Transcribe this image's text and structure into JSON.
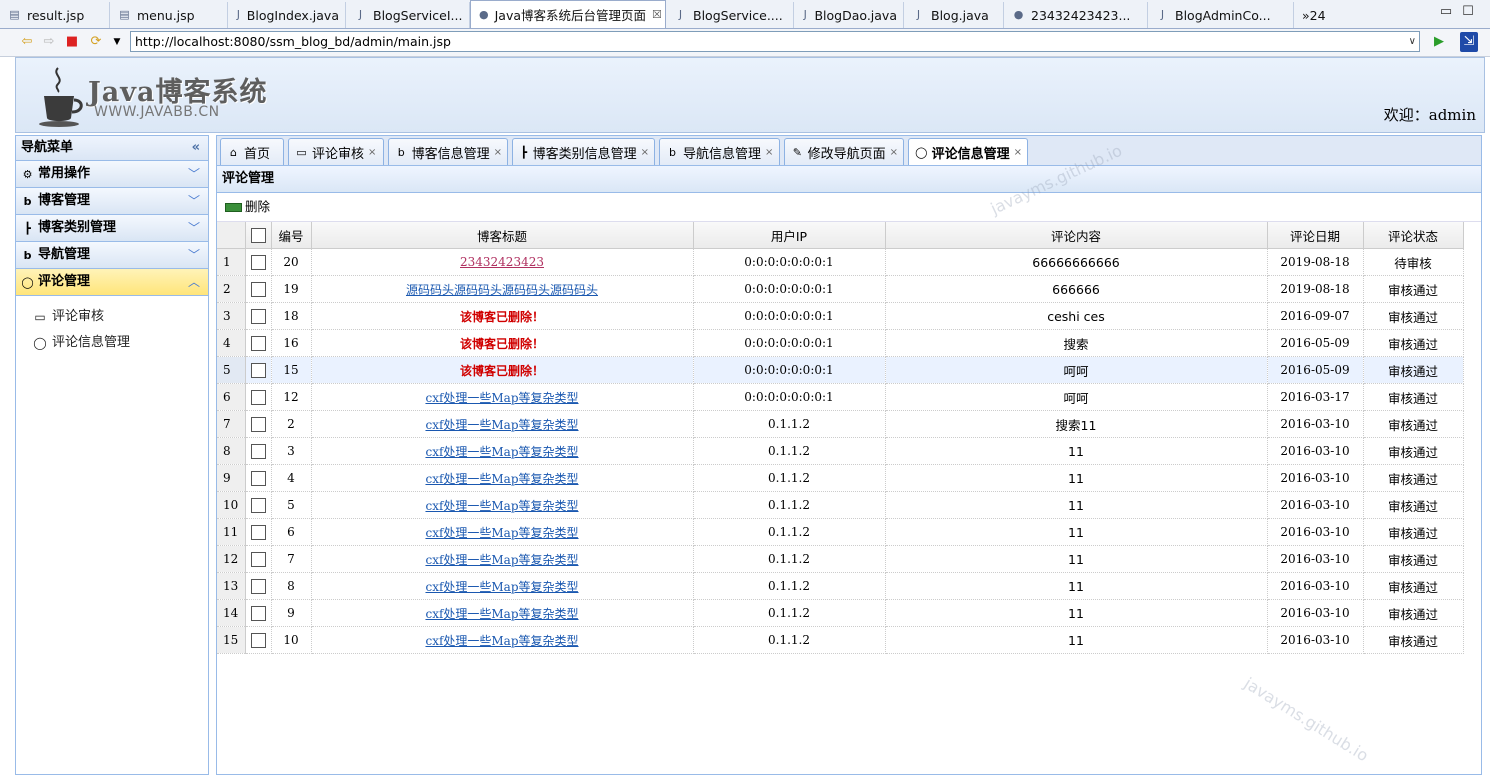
{
  "editor_tabs": [
    {
      "label": "result.jsp",
      "icon": "file-icon",
      "active": false
    },
    {
      "label": "menu.jsp",
      "icon": "file-icon",
      "active": false
    },
    {
      "label": "BlogIndex.java",
      "icon": "java-file-icon",
      "active": false
    },
    {
      "label": "BlogServiceI...",
      "icon": "java-file-icon",
      "active": false
    },
    {
      "label": "Java博客系统后台管理页面",
      "icon": "globe-icon",
      "active": true
    },
    {
      "label": "BlogService....",
      "icon": "java-file-icon",
      "active": false
    },
    {
      "label": "BlogDao.java",
      "icon": "java-file-icon",
      "active": false
    },
    {
      "label": "Blog.java",
      "icon": "java-file-icon",
      "active": false
    },
    {
      "label": "23432423423...",
      "icon": "globe-icon",
      "active": false
    },
    {
      "label": "BlogAdminCo...",
      "icon": "java-file-icon",
      "active": false
    }
  ],
  "overflow_tabs": "»24",
  "address": {
    "url": "http://localhost:8080/ssm_blog_bd/admin/main.jsp"
  },
  "header": {
    "logo_title": "Java博客系统",
    "logo_sub": "WWW.JAVABB.CN",
    "welcome": "欢迎：admin"
  },
  "nav": {
    "title": "导航菜单",
    "sections": [
      {
        "label": "常用操作",
        "icon": "gear-icon",
        "open": false
      },
      {
        "label": "博客管理",
        "icon": "blog-icon",
        "open": false
      },
      {
        "label": "博客类别管理",
        "icon": "tree-icon",
        "open": false
      },
      {
        "label": "导航管理",
        "icon": "blog-icon",
        "open": false
      },
      {
        "label": "评论管理",
        "icon": "comment-icon",
        "open": true
      }
    ],
    "sub_items": [
      {
        "label": "评论审核",
        "icon": "comment-edit-icon"
      },
      {
        "label": "评论信息管理",
        "icon": "comment-icon"
      }
    ]
  },
  "main_tabs": [
    {
      "label": "首页",
      "icon": "home-icon",
      "closable": false,
      "active": false
    },
    {
      "label": "评论审核",
      "icon": "comment-edit-icon",
      "closable": true,
      "active": false
    },
    {
      "label": "博客信息管理",
      "icon": "blog-icon",
      "closable": true,
      "active": false
    },
    {
      "label": "博客类别信息管理",
      "icon": "tree-icon",
      "closable": true,
      "active": false
    },
    {
      "label": "导航信息管理",
      "icon": "blog-icon",
      "closable": true,
      "active": false
    },
    {
      "label": "修改导航页面",
      "icon": "edit-icon",
      "closable": true,
      "active": false
    },
    {
      "label": "评论信息管理",
      "icon": "comment-icon",
      "closable": true,
      "active": true
    }
  ],
  "panel": {
    "title": "评论管理",
    "delete_label": "删除"
  },
  "table": {
    "columns": [
      "编号",
      "博客标题",
      "用户IP",
      "评论内容",
      "评论日期",
      "评论状态"
    ],
    "rows": [
      {
        "n": "1",
        "id": "20",
        "title": "23432423423",
        "title_style": "link-red",
        "ip": "0:0:0:0:0:0:0:1",
        "content": "66666666666",
        "date": "2019-08-18",
        "status": "待审核"
      },
      {
        "n": "2",
        "id": "19",
        "title": "源码码头源码码头源码码头源码码头",
        "title_style": "link",
        "ip": "0:0:0:0:0:0:0:1",
        "content": "666666",
        "date": "2019-08-18",
        "status": "审核通过"
      },
      {
        "n": "3",
        "id": "18",
        "title": "该博客已删除！",
        "title_style": "deleted",
        "ip": "0:0:0:0:0:0:0:1",
        "content": "ceshi ces",
        "date": "2016-09-07",
        "status": "审核通过"
      },
      {
        "n": "4",
        "id": "16",
        "title": "该博客已删除！",
        "title_style": "deleted",
        "ip": "0:0:0:0:0:0:0:1",
        "content": "搜索",
        "date": "2016-05-09",
        "status": "审核通过"
      },
      {
        "n": "5",
        "id": "15",
        "title": "该博客已删除！",
        "title_style": "deleted",
        "ip": "0:0:0:0:0:0:0:1",
        "content": "呵呵",
        "date": "2016-05-09",
        "status": "审核通过",
        "highlight": true
      },
      {
        "n": "6",
        "id": "12",
        "title": "cxf处理一些Map等复杂类型",
        "title_style": "link",
        "ip": "0:0:0:0:0:0:0:1",
        "content": "呵呵",
        "date": "2016-03-17",
        "status": "审核通过"
      },
      {
        "n": "7",
        "id": "2",
        "title": "cxf处理一些Map等复杂类型",
        "title_style": "link",
        "ip": "0.1.1.2",
        "content": "搜索11",
        "date": "2016-03-10",
        "status": "审核通过"
      },
      {
        "n": "8",
        "id": "3",
        "title": "cxf处理一些Map等复杂类型",
        "title_style": "link",
        "ip": "0.1.1.2",
        "content": "11",
        "date": "2016-03-10",
        "status": "审核通过"
      },
      {
        "n": "9",
        "id": "4",
        "title": "cxf处理一些Map等复杂类型",
        "title_style": "link",
        "ip": "0.1.1.2",
        "content": "11",
        "date": "2016-03-10",
        "status": "审核通过"
      },
      {
        "n": "10",
        "id": "5",
        "title": "cxf处理一些Map等复杂类型",
        "title_style": "link",
        "ip": "0.1.1.2",
        "content": "11",
        "date": "2016-03-10",
        "status": "审核通过"
      },
      {
        "n": "11",
        "id": "6",
        "title": "cxf处理一些Map等复杂类型",
        "title_style": "link",
        "ip": "0.1.1.2",
        "content": "11",
        "date": "2016-03-10",
        "status": "审核通过"
      },
      {
        "n": "12",
        "id": "7",
        "title": "cxf处理一些Map等复杂类型",
        "title_style": "link",
        "ip": "0.1.1.2",
        "content": "11",
        "date": "2016-03-10",
        "status": "审核通过"
      },
      {
        "n": "13",
        "id": "8",
        "title": "cxf处理一些Map等复杂类型",
        "title_style": "link",
        "ip": "0.1.1.2",
        "content": "11",
        "date": "2016-03-10",
        "status": "审核通过"
      },
      {
        "n": "14",
        "id": "9",
        "title": "cxf处理一些Map等复杂类型",
        "title_style": "link",
        "ip": "0.1.1.2",
        "content": "11",
        "date": "2016-03-10",
        "status": "审核通过"
      },
      {
        "n": "15",
        "id": "10",
        "title": "cxf处理一些Map等复杂类型",
        "title_style": "link",
        "ip": "0.1.1.2",
        "content": "11",
        "date": "2016-03-10",
        "status": "审核通过"
      }
    ]
  },
  "watermarks": [
    "javayms.github.io",
    "javayms.github.io"
  ]
}
